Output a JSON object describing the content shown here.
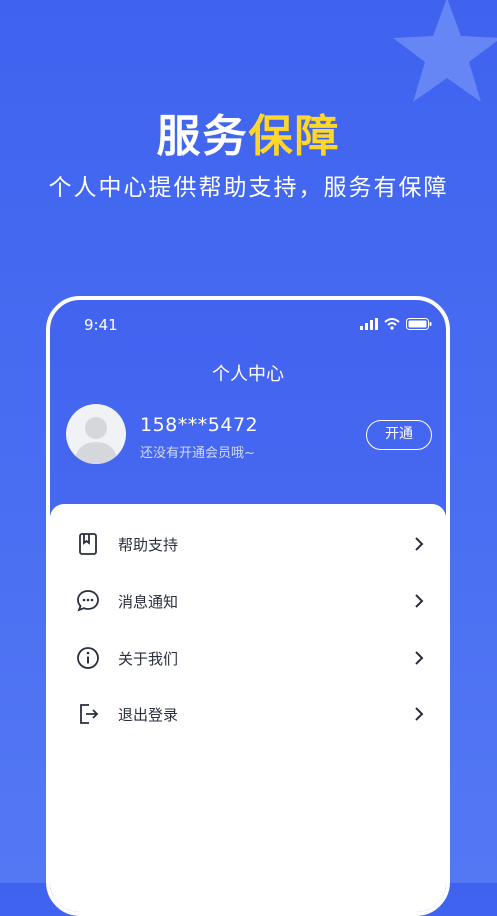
{
  "headline": {
    "part1": "服务",
    "part2": "保障"
  },
  "subline": "个人中心提供帮助支持，服务有保障",
  "status_bar": {
    "time": "9:41"
  },
  "profile": {
    "page_title": "个人中心",
    "phone": "158***5472",
    "member_hint": "还没有开通会员哦~",
    "open_button": "开通"
  },
  "menu": [
    {
      "label": "帮助支持",
      "icon": "book-icon"
    },
    {
      "label": "消息通知",
      "icon": "chat-bubble-icon"
    },
    {
      "label": "关于我们",
      "icon": "info-icon"
    },
    {
      "label": "退出登录",
      "icon": "logout-icon"
    }
  ],
  "colors": {
    "background": "#4a6ff2",
    "highlight": "#ffd62b",
    "white": "#ffffff"
  }
}
